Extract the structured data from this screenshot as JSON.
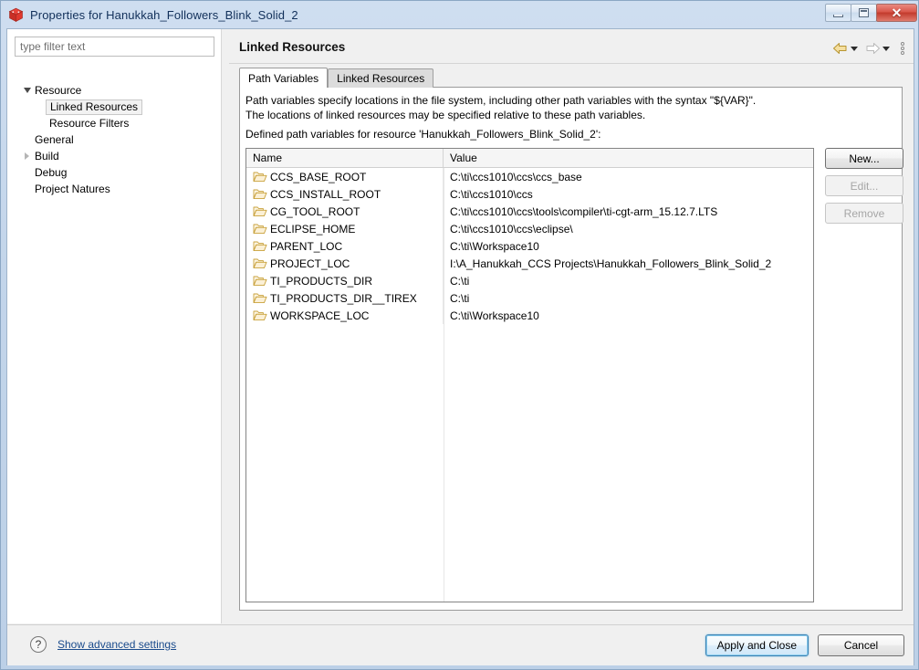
{
  "window": {
    "title": "Properties for Hanukkah_Followers_Blink_Solid_2",
    "app_icon": "cube-icon",
    "minimize_label": "Minimize",
    "maximize_label": "Maximize",
    "close_label": "✕",
    "accent_color": "#1a4b8c",
    "titlebar_color": "#c3d5ea"
  },
  "sidebar": {
    "filter": {
      "placeholder": "type filter text",
      "value": ""
    },
    "items": [
      {
        "label": "Resource",
        "indent": 0,
        "state": "expanded",
        "selected": false
      },
      {
        "label": "Linked Resources",
        "indent": 1,
        "state": "leaf",
        "selected": true
      },
      {
        "label": "Resource Filters",
        "indent": 1,
        "state": "leaf",
        "selected": false
      },
      {
        "label": "General",
        "indent": 0,
        "state": "leaf",
        "selected": false
      },
      {
        "label": "Build",
        "indent": 0,
        "state": "collapsed",
        "selected": false
      },
      {
        "label": "Debug",
        "indent": 0,
        "state": "leaf",
        "selected": false
      },
      {
        "label": "Project Natures",
        "indent": 0,
        "state": "leaf",
        "selected": false
      }
    ]
  },
  "page": {
    "title": "Linked Resources",
    "nav": {
      "back_icon": "back-arrow-icon",
      "back_menu_icon": "chevron-down-icon",
      "forward_icon": "forward-arrow-icon",
      "forward_menu_icon": "chevron-down-icon",
      "menu_icon": "vertical-dots-icon"
    },
    "tabs": [
      {
        "label": "Path Variables",
        "active": true
      },
      {
        "label": "Linked Resources",
        "active": false
      }
    ],
    "description": {
      "line1": "Path variables specify locations in the file system, including other path variables with the syntax \"${VAR}\".",
      "line2": "The locations of linked resources may be specified relative to these path variables.",
      "line3": "Defined path variables for resource 'Hanukkah_Followers_Blink_Solid_2':"
    },
    "table": {
      "columns": [
        "Name",
        "Value"
      ],
      "row_icon": "folder-icon",
      "rows": [
        {
          "name": "CCS_BASE_ROOT",
          "value": "C:\\ti\\ccs1010\\ccs\\ccs_base"
        },
        {
          "name": "CCS_INSTALL_ROOT",
          "value": "C:\\ti\\ccs1010\\ccs"
        },
        {
          "name": "CG_TOOL_ROOT",
          "value": "C:\\ti\\ccs1010\\ccs\\tools\\compiler\\ti-cgt-arm_15.12.7.LTS"
        },
        {
          "name": "ECLIPSE_HOME",
          "value": "C:\\ti\\ccs1010\\ccs\\eclipse\\"
        },
        {
          "name": "PARENT_LOC",
          "value": "C:\\ti\\Workspace10"
        },
        {
          "name": "PROJECT_LOC",
          "value": "I:\\A_Hanukkah_CCS Projects\\Hanukkah_Followers_Blink_Solid_2"
        },
        {
          "name": "TI_PRODUCTS_DIR",
          "value": "C:\\ti"
        },
        {
          "name": "TI_PRODUCTS_DIR__TIREX",
          "value": "C:\\ti"
        },
        {
          "name": "WORKSPACE_LOC",
          "value": "C:\\ti\\Workspace10"
        }
      ]
    },
    "side_buttons": [
      {
        "label": "New...",
        "enabled": true
      },
      {
        "label": "Edit...",
        "enabled": false
      },
      {
        "label": "Remove",
        "enabled": false
      }
    ]
  },
  "footer": {
    "help_icon": "question-mark-icon",
    "help_glyph": "?",
    "advanced_link": "Show advanced settings",
    "buttons": [
      {
        "label": "Apply and Close",
        "default": true
      },
      {
        "label": "Cancel",
        "default": false
      }
    ]
  }
}
